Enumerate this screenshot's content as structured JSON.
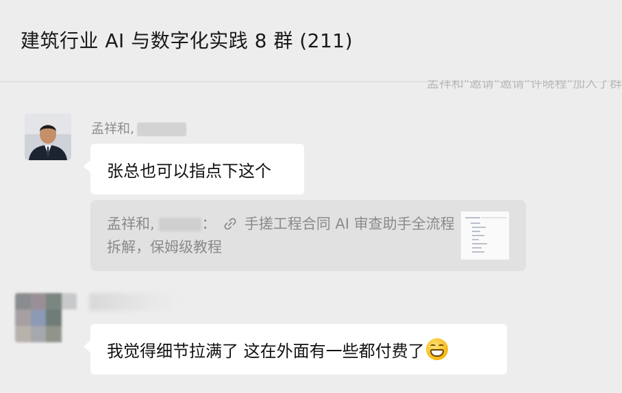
{
  "chat": {
    "title": "建筑行业 AI 与数字化实践 8 群 (211)",
    "system_notice": "孟祥和\"邀请\"邀请\"许晓程\"加入了群"
  },
  "messages": [
    {
      "sender_name": "孟祥和,",
      "text": "张总也可以指点下这个",
      "quote": {
        "sender_prefix": "孟祥和,",
        "sender_suffix": "：",
        "link_icon": "link-icon",
        "text": "手搓工程合同 AI 审查助手全流程拆解，保姆级教程"
      }
    },
    {
      "text": "我觉得细节拉满了    这在外面有一些都付费了",
      "emoji": "grinning-face-emoji"
    }
  ],
  "colors": {
    "background": "#ededed",
    "bubble": "#ffffff",
    "quote_bg": "#e1e1e1",
    "muted_text": "#8e8e8e"
  }
}
